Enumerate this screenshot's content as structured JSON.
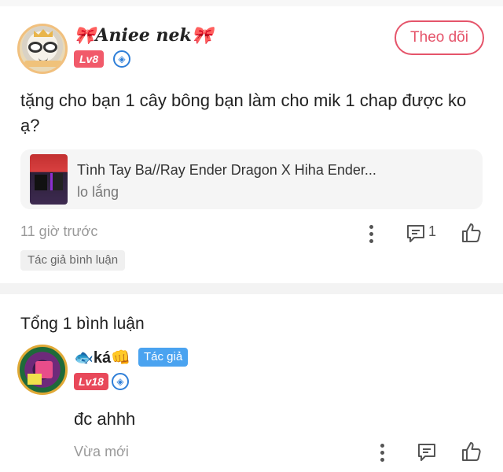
{
  "post": {
    "username": "🎀Aniee nek🎀",
    "level": "Lv8",
    "follow_label": "Theo dõi",
    "text": "tặng cho bạn 1 cây bông bạn làm cho mik 1 chap được ko ạ?",
    "story": {
      "title": "Tình Tay Ba//Ray Ender Dragon X Hiha Ender...",
      "subtitle": "lo lắng"
    },
    "time": "11 giờ trước",
    "comment_count": "1",
    "author_tag": "Tác giả bình luận"
  },
  "comments_header": "Tổng 1 bình luận",
  "comment": {
    "username": "🐟ká👊",
    "author_badge": "Tác giả",
    "level": "Lv18",
    "text": "đc ahhh",
    "time": "Vừa mới"
  },
  "icons": {
    "verify": "verified-shield-icon",
    "more": "more-vertical-icon",
    "comment": "comment-icon",
    "like": "thumbs-up-icon"
  },
  "colors": {
    "accent": "#e5546a",
    "level_badge": "#f15a6a",
    "author_badge": "#4aa3f0",
    "verify": "#2f7fd8"
  }
}
